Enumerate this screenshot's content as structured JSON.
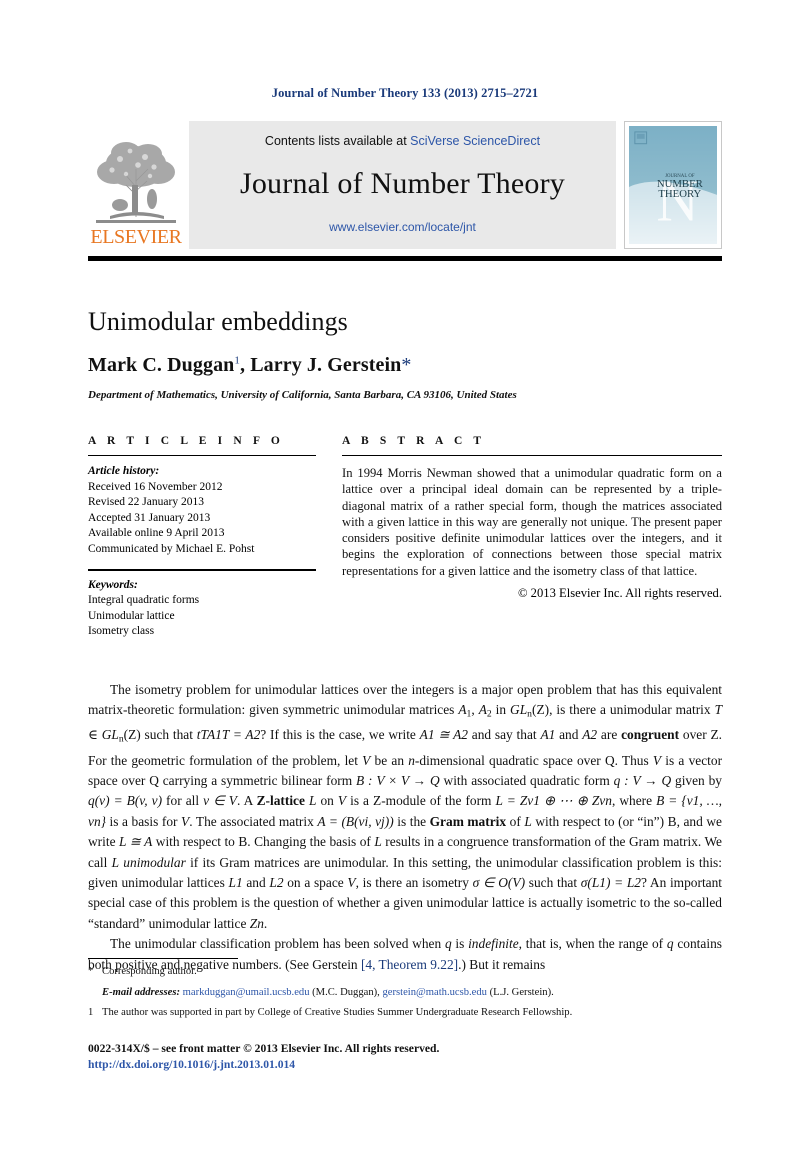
{
  "running_head": "Journal of Number Theory 133 (2013) 2715–2721",
  "masthead": {
    "publisher_name": "ELSEVIER",
    "contents_prefix": "Contents lists available at ",
    "contents_link": "SciVerse ScienceDirect",
    "journal_title": "Journal of Number Theory",
    "journal_url": "www.elsevier.com/locate/jnt",
    "cover": {
      "line1": "JOURNAL OF",
      "line2": "NUMBER",
      "line3": "THEORY",
      "big_letter": "N"
    },
    "colors": {
      "elsevier_orange": "#E87722",
      "link_blue": "#2d56a8",
      "cover_teal": "#7fb3c8",
      "panel_grey": "#e9e9e9"
    }
  },
  "article": {
    "title": "Unimodular embeddings",
    "authors": "Mark C. Duggan",
    "author1_marker": "1",
    "author2": ", Larry J. Gerstein",
    "author2_marker": "*",
    "affiliation": "Department of Mathematics, University of California, Santa Barbara, CA 93106, United States"
  },
  "info": {
    "heading": "A R T I C L E   I N F O",
    "history_label": "Article history:",
    "history": [
      "Received 16 November 2012",
      "Revised 22 January 2013",
      "Accepted 31 January 2013",
      "Available online 9 April 2013",
      "Communicated by Michael E. Pohst"
    ],
    "keywords_label": "Keywords:",
    "keywords": [
      "Integral quadratic forms",
      "Unimodular lattice",
      "Isometry class"
    ]
  },
  "abstract": {
    "heading": "A B S T R A C T",
    "text": "In 1994 Morris Newman showed that a unimodular quadratic form on a lattice over a principal ideal domain can be represented by a triple-diagonal matrix of a rather special form, though the matrices associated with a given lattice in this way are generally not unique. The present paper considers positive definite unimodular lattices over the integers, and it begins the exploration of connections between those special matrix representations for a given lattice and the isometry class of that lattice.",
    "copyright": "© 2013 Elsevier Inc. All rights reserved."
  },
  "body": {
    "paragraph1_part1": "The isometry problem for unimodular lattices over the integers is a major open problem that has this equivalent matrix-theoretic formulation: given symmetric unimodular matrices ",
    "p1_a1": "A",
    "p1_sub1": "1",
    "p1_comma": ", ",
    "p1_a2": "A",
    "p1_sub2": "2",
    "p1_in": " in ",
    "p1_gl": "GL",
    "p1_gl_sub": "n",
    "p1_gl_z": "(Z), is there a unimodular matrix ",
    "p1_t": "T",
    "p1_elem": " ∈ ",
    "p1_gl2": "GL",
    "p1_gl2_sub": "n",
    "p1_gl2_z": "(Z) such that ",
    "p1_eq": "tTA1T = A2",
    "p1_after_eq": "? If this is the case, we write ",
    "p1_iso": "A1 ≅ A2",
    "p1_tail": " and say that ",
    "p1_a1b": "A1",
    "p1_and": " and ",
    "p1_a2b": "A2",
    "p1_are": " are ",
    "p1_congruent": "congruent",
    "p1_overz": " over Z. For the geometric formulation of the problem, let ",
    "p1_V": "V",
    "p1_be": " be an ",
    "p1_n": "n",
    "p1_dim": "-dimensional quadratic space over Q. Thus ",
    "p1_V2": "V",
    "p1_isvec": " is a vector space over Q carrying a symmetric bilinear form ",
    "p1_B": "B : V × V → Q",
    "p1_withq": " with associated quadratic form ",
    "p1_q": "q : V → Q",
    "p1_givenby": " given by ",
    "p1_qv": "q(v) = B(v, v)",
    "p1_forall": " for all ",
    "p1_vinV": "v ∈ V",
    "p1_azl": ". A ",
    "p1_zlat": "Z-lattice",
    "p1_L": " L",
    "p1_onV": " on ",
    "p1_V3": "V",
    "p1_zmod": " is a Z-module of the form ",
    "p1_Lform": "L = Zv1 ⊕ ⋯ ⊕ Zvn",
    "p1_where": ", where ",
    "p1_basis": "B = {v1, …, vn}",
    "p1_isbasis": " is a basis for ",
    "p1_V4": "V",
    "p1_assoc": ". The associated matrix ",
    "p1_A": "A = (B(vi, vj))",
    "p1_isthe": " is the ",
    "p1_gram": "Gram matrix",
    "p1_of": " of ",
    "p1_L2": "L",
    "p1_wrt": " with respect to (or “in”) B, and we write ",
    "p1_LA": "L ≅ A",
    "p1_wrt2": " with respect to B. Changing the basis of ",
    "p1_L3": "L",
    "p1_results": " results in a congruence transformation of the Gram matrix. We call ",
    "p1_L4": "L",
    "p1_unimod": " unimodular",
    "p1_ifits": " if its Gram matrices are unimodular. In this setting, the unimodular classification problem is this: given unimodular lattices ",
    "p1_L1L2": "L1",
    "p1_and2": " and ",
    "p1_L2b": "L2",
    "p1_onaspace": " on a space ",
    "p1_V5": "V",
    "p1_isthere": ", is there an isometry ",
    "p1_sigma": "σ ∈ O(V)",
    "p1_suchthat": " such that ",
    "p1_sigmaL": "σ(L1) = L2",
    "p1_important": "? An important special case of this problem is the question of whether a given unimodular lattice is actually isometric to the so-called “standard” unimodular lattice ",
    "p1_Zn": "Zn",
    "p1_period": ".",
    "paragraph2_a": "The unimodular classification problem has been solved when ",
    "p2_q": "q",
    "p2_is": " is ",
    "p2_indef": "indefinite",
    "p2_that": ", that is, when the range of ",
    "p2_q2": "q",
    "p2_contains": " contains both positive and negative numbers. (See Gerstein ",
    "p2_cite": "[4, Theorem 9.22]",
    "p2_end": ".) But it remains"
  },
  "footnotes": {
    "corresponding_mark": "*",
    "corresponding_text": "Corresponding author.",
    "email_label": "E-mail addresses:",
    "email1": "markduggan@umail.ucsb.edu",
    "email1_who": " (M.C. Duggan), ",
    "email2": "gerstein@math.ucsb.edu",
    "email2_who": " (L.J. Gerstein).",
    "fn1_mark": "1",
    "fn1_text": "The author was supported in part by College of Creative Studies Summer Undergraduate Research Fellowship."
  },
  "imprint": {
    "issn_line": "0022-314X/$ – see front matter  © 2013 Elsevier Inc. All rights reserved.",
    "doi": "http://dx.doi.org/10.1016/j.jnt.2013.01.014"
  }
}
